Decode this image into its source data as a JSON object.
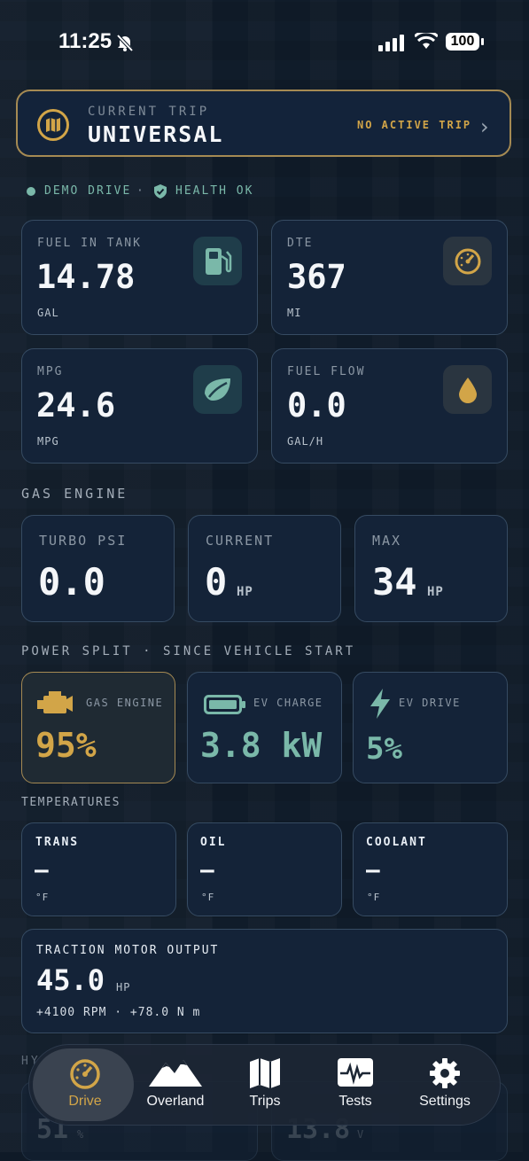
{
  "status_bar": {
    "time": "11:25",
    "battery": "100"
  },
  "trip": {
    "kicker": "CURRENT TRIP",
    "title": "UNIVERSAL",
    "status": "NO ACTIVE TRIP"
  },
  "status_row": {
    "demo": "DEMO DRIVE",
    "separator": "·",
    "health": "HEALTH OK"
  },
  "fuel": {
    "fuel_in_tank": {
      "label": "FUEL IN TANK",
      "value": "14.78",
      "unit": "GAL"
    },
    "dte": {
      "label": "DTE",
      "value": "367",
      "unit": "MI"
    },
    "mpg": {
      "label": "MPG",
      "value": "24.6",
      "unit": "MPG"
    },
    "fuel_flow": {
      "label": "FUEL FLOW",
      "value": "0.0",
      "unit": "GAL/H"
    }
  },
  "gas_engine": {
    "section": "GAS ENGINE",
    "turbo": {
      "label": "TURBO PSI",
      "value": "0.0"
    },
    "current": {
      "label": "CURRENT",
      "value": "0",
      "unit": "HP"
    },
    "max": {
      "label": "MAX",
      "value": "34",
      "unit": "HP"
    }
  },
  "power_split": {
    "section": "POWER SPLIT · SINCE VEHICLE START",
    "gas": {
      "label": "GAS ENGINE",
      "value": "95%"
    },
    "ev_charge": {
      "label": "EV CHARGE",
      "value": "3.8 kW"
    },
    "ev_drive": {
      "label": "EV DRIVE",
      "value": "5%"
    }
  },
  "temperatures": {
    "section": "TEMPERATURES",
    "trans": {
      "label": "TRANS",
      "value": "—",
      "unit": "°F"
    },
    "oil": {
      "label": "OIL",
      "value": "—",
      "unit": "°F"
    },
    "coolant": {
      "label": "COOLANT",
      "value": "—",
      "unit": "°F"
    }
  },
  "traction": {
    "label": "TRACTION MOTOR OUTPUT",
    "value": "45.0",
    "unit": "HP",
    "detail": "+4100 RPM · +78.0 N m"
  },
  "peek": {
    "section": "HY",
    "left_value": "51",
    "left_unit": "%",
    "right_value": "13.8",
    "right_unit": "V"
  },
  "nav": {
    "items": [
      {
        "label": "Drive",
        "icon": "gauge-icon"
      },
      {
        "label": "Overland",
        "icon": "mountains-icon"
      },
      {
        "label": "Trips",
        "icon": "map-icon"
      },
      {
        "label": "Tests",
        "icon": "waveform-icon"
      },
      {
        "label": "Settings",
        "icon": "gear-icon"
      }
    ]
  },
  "colors": {
    "accent_gold": "#d2a548",
    "accent_teal": "#7ab8a9",
    "card_bg": "#142338",
    "border": "#364b62"
  }
}
